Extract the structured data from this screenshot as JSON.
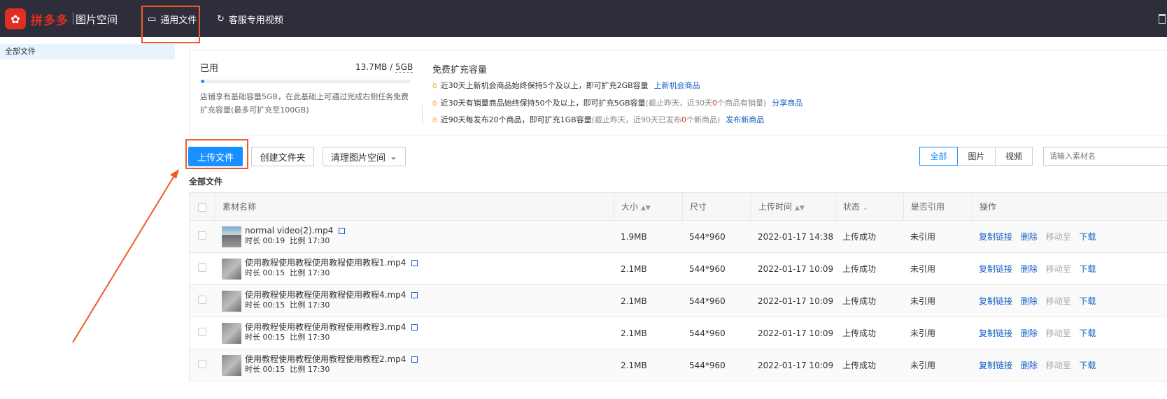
{
  "header": {
    "brand": "拼多多",
    "app_title": "图片空间",
    "tabs": [
      {
        "label": "通用文件",
        "active": true
      },
      {
        "label": "客服专用视频",
        "active": false
      }
    ]
  },
  "sidebar": {
    "items": [
      {
        "label": "全部文件",
        "active": true
      }
    ]
  },
  "storage": {
    "used_label": "已用",
    "used": "13.7MB",
    "separator": "/",
    "total": "5GB",
    "used_fraction": 0.0027,
    "description": "店铺享有基础容量5GB，在此基础上可通过完成右侧任务免费扩充容量(最多可扩充至100GB)",
    "free_title": "免费扩充容量",
    "tasks": [
      {
        "text": "近30天上新机会商品始终保持5个及以上，即可扩充2GB容量",
        "note_pre": "",
        "note_red": "",
        "note_post": "",
        "link": "上新机会商品"
      },
      {
        "text": "近30天有销量商品始终保持50个及以上，即可扩充5GB容量",
        "note_pre": "(截止昨天，近30天",
        "note_red": "0",
        "note_post": "个商品有销量)",
        "link": "分享商品"
      },
      {
        "text": "近90天每发布20个商品，即可扩充1GB容量",
        "note_pre": "(截止昨天，近90天已发布",
        "note_red": "0",
        "note_post": "个新商品)",
        "link": "发布新商品"
      }
    ]
  },
  "toolbar": {
    "upload": "上传文件",
    "mkdir": "创建文件夹",
    "clean": "清理图片空间",
    "filters": [
      "全部",
      "图片",
      "视频"
    ],
    "active_filter": "全部",
    "search_placeholder": "请输入素材名"
  },
  "section_title": "全部文件",
  "table": {
    "columns": [
      "素材名称",
      "大小",
      "尺寸",
      "上传时间",
      "状态",
      "是否引用",
      "操作"
    ],
    "ops": [
      "复制链接",
      "删除",
      "移动至",
      "下载"
    ],
    "rows": [
      {
        "name": "normal video(2).mp4",
        "duration_label": "时长",
        "duration": "00:19",
        "ratio_label": "比例",
        "ratio": "17:30",
        "size": "1.9MB",
        "dim": "544*960",
        "time": "2022-01-17 14:38",
        "status": "上传成功",
        "ref": "未引用"
      },
      {
        "name": "使用教程使用教程使用教程使用教程1.mp4",
        "duration_label": "时长",
        "duration": "00:15",
        "ratio_label": "比例",
        "ratio": "17:30",
        "size": "2.1MB",
        "dim": "544*960",
        "time": "2022-01-17 10:09",
        "status": "上传成功",
        "ref": "未引用"
      },
      {
        "name": "使用教程使用教程使用教程使用教程4.mp4",
        "duration_label": "时长",
        "duration": "00:15",
        "ratio_label": "比例",
        "ratio": "17:30",
        "size": "2.1MB",
        "dim": "544*960",
        "time": "2022-01-17 10:09",
        "status": "上传成功",
        "ref": "未引用"
      },
      {
        "name": "使用教程使用教程使用教程使用教程3.mp4",
        "duration_label": "时长",
        "duration": "00:15",
        "ratio_label": "比例",
        "ratio": "17:30",
        "size": "2.1MB",
        "dim": "544*960",
        "time": "2022-01-17 10:09",
        "status": "上传成功",
        "ref": "未引用"
      },
      {
        "name": "使用教程使用教程使用教程使用教程2.mp4",
        "duration_label": "时长",
        "duration": "00:15",
        "ratio_label": "比例",
        "ratio": "17:30",
        "size": "2.1MB",
        "dim": "544*960",
        "time": "2022-01-17 10:09",
        "status": "上传成功",
        "ref": "未引用"
      }
    ]
  },
  "colors": {
    "topbar": "#2e2e3a",
    "brand": "#e02e24",
    "accent": "#1890ff",
    "link": "#1a5fc4",
    "annotation": "#f05a28"
  }
}
